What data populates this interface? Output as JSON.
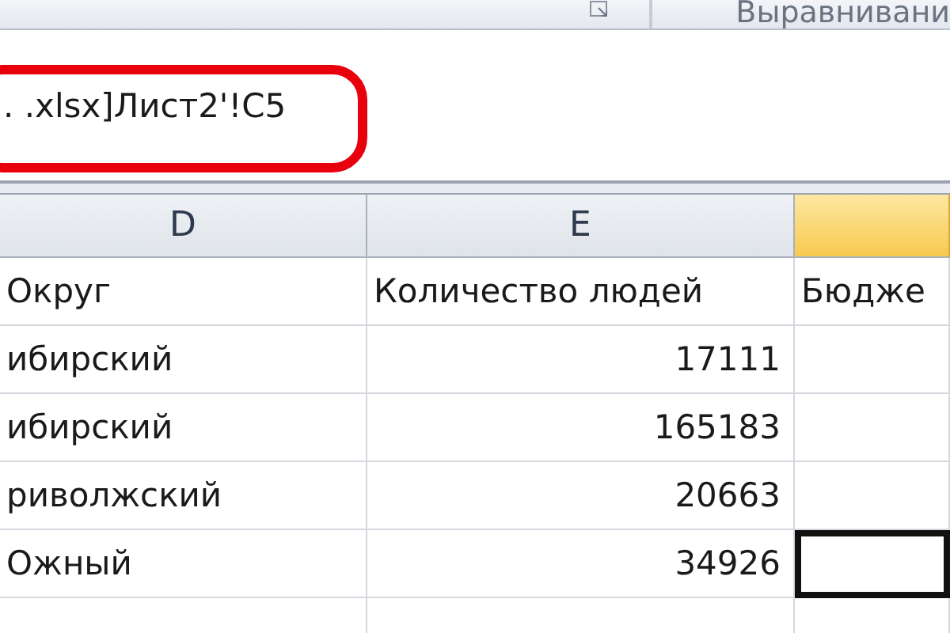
{
  "ribbon": {
    "group_label": "Выравнивани"
  },
  "formula_bar": {
    "value": ". .xlsx]Лист2'!C5",
    "highlighted": true
  },
  "columns": [
    {
      "label": "D",
      "selected": false
    },
    {
      "label": "E",
      "selected": false
    },
    {
      "selected": true
    }
  ],
  "rows": [
    {
      "cells": [
        {
          "text": "Округ",
          "selected": false
        },
        {
          "text": "Количество людей",
          "selected": false
        },
        {
          "text": "Бюдже",
          "selected": false
        }
      ]
    },
    {
      "cells": [
        {
          "text": "ибирский",
          "selected": false
        },
        {
          "text": "17111",
          "selected": false
        },
        {
          "selected": false
        }
      ]
    },
    {
      "cells": [
        {
          "text": "ибирский",
          "selected": false
        },
        {
          "text": "165183",
          "selected": false
        },
        {
          "selected": false
        }
      ]
    },
    {
      "cells": [
        {
          "text": "риволжский",
          "selected": false
        },
        {
          "text": "20663",
          "selected": false
        },
        {
          "selected": false
        }
      ]
    },
    {
      "cells": [
        {
          "text": "Ожный",
          "selected": false
        },
        {
          "text": "34926",
          "selected": false
        },
        {
          "selected": true
        }
      ]
    }
  ]
}
